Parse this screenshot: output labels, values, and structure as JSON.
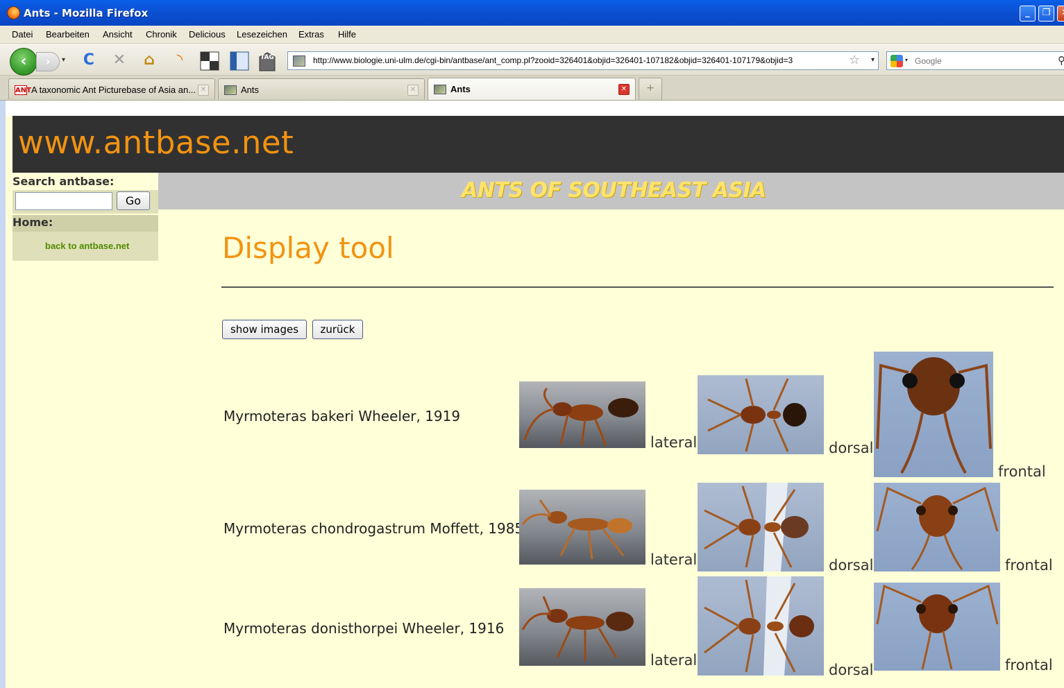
{
  "window": {
    "title": "Ants - Mozilla Firefox",
    "buttons": {
      "minimize": "_",
      "maximize": "❐",
      "close": "✕"
    }
  },
  "menu": [
    "Datei",
    "Bearbeiten",
    "Ansicht",
    "Chronik",
    "Delicious",
    "Lesezeichen",
    "Extras",
    "Hilfe"
  ],
  "toolbar": {
    "back": "‹",
    "forward": "›",
    "dropdown": "▾",
    "reload": "C",
    "stop": "✕",
    "home": "⌂",
    "rss": "◝",
    "tag": "TAG",
    "url": "http://www.biologie.uni-ulm.de/cgi-bin/antbase/ant_comp.pl?zooid=326401&objid=326401-107182&objid=326401-107179&objid=3",
    "star": "☆",
    "search_placeholder": "Google",
    "search_icon": "⚲"
  },
  "tabs": [
    {
      "label": "A taxonomic Ant Picturebase of Asia an...",
      "favicon": "ANT",
      "close": "✕",
      "active": false
    },
    {
      "label": "Ants",
      "favicon": "",
      "close": "✕",
      "active": false
    },
    {
      "label": "Ants",
      "favicon": "",
      "close": "✕",
      "active": true
    }
  ],
  "newtab": "+",
  "site": {
    "logo": "www.antbase.net",
    "tagline": "ANTS OF SOUTHEAST ASIA",
    "search_label": "Search antbase:",
    "search_value": "",
    "go_label": "Go",
    "home_label": "Home:",
    "home_link": "back to antbase.net",
    "title": "Display tool",
    "show_images_label": "show images",
    "back_label": "zurück"
  },
  "species": [
    {
      "name": "Myrmoteras bakeri Wheeler, 1919",
      "views": [
        "lateral",
        "dorsal",
        "frontal"
      ]
    },
    {
      "name": "Myrmoteras chondrogastrum Moffett, 1985",
      "views": [
        "lateral",
        "dorsal",
        "frontal"
      ]
    },
    {
      "name": "Myrmoteras donisthorpei Wheeler, 1916",
      "views": [
        "lateral",
        "dorsal",
        "frontal"
      ]
    }
  ]
}
